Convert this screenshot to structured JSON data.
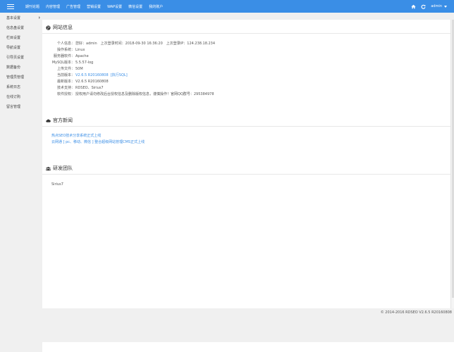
{
  "topbar": {
    "nav": [
      "期刊论题",
      "内容管理",
      "广告管理",
      "营销设置",
      "WAP设置",
      "微信设置",
      "我的账户"
    ],
    "user": "admin",
    "accent": "#3a8ee6"
  },
  "sidebar": {
    "items": [
      "基本设置",
      "信息盘设置",
      "栏目设置",
      "导航设置",
      "引导页设置",
      "数据备份",
      "管理员管理",
      "系统日志",
      "在线订购",
      "留言管理"
    ]
  },
  "sections": {
    "site_info": "网站信息",
    "news": "官方新闻",
    "team": "研发团队"
  },
  "site_info": {
    "rows": [
      {
        "label": "个人信息：",
        "value": "您好：admin　上次登录时间：2018-09-30 16:36:20　上次登录IP：124.238.18.234"
      },
      {
        "label": "操作系统：",
        "value": "Linux"
      },
      {
        "label": "服务器软件：",
        "value": "Apache"
      },
      {
        "label": "MySQL版本：",
        "value": "5.5.57-log"
      },
      {
        "label": "上传文件：",
        "value": "50M"
      },
      {
        "label": "当前版本：",
        "value": "V2.6.5 R20160808",
        "link": "[执行SQL]"
      },
      {
        "label": "最新版本：",
        "value": "V2.6.5 R20160808"
      },
      {
        "label": "技术支持：",
        "value": "RDSEO、Sirius7"
      },
      {
        "label": "软件授权：",
        "value": "授权用户请勿修改后台授权信息及删除版权信息，谨慎操作！官网QQ群号：295384978"
      }
    ]
  },
  "news": [
    "热点SEO技术分享系统正式上线",
    "云网通 [ pc、移动、微信 ] 整合超级网站管理CMS正式上线"
  ],
  "team": "Sirius7",
  "footer": "© 2014-2016 RDSEO V2.6.5 R20160808"
}
